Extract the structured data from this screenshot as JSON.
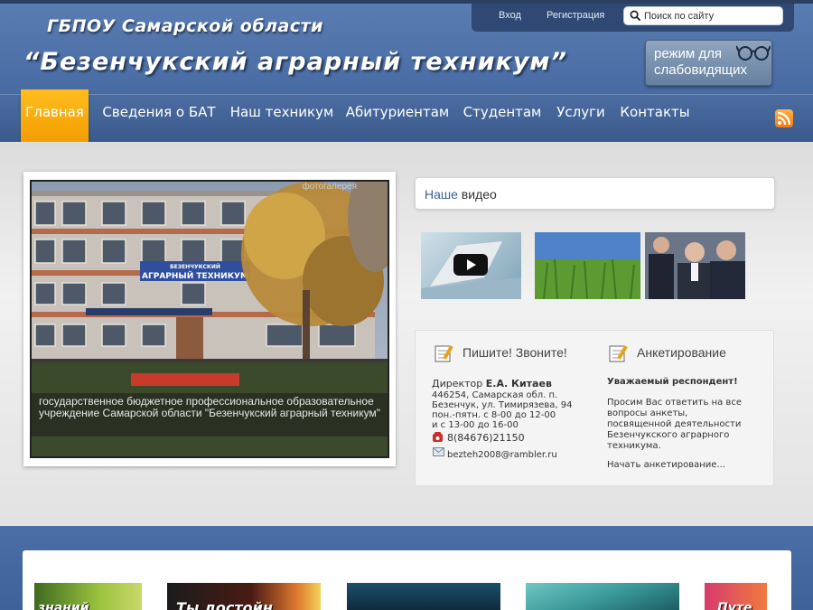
{
  "header": {
    "subtitle": "ГБПОУ Самарской области",
    "title": "“Безенчукский аграрный техникум”",
    "login": "Вход",
    "register": "Регистрация",
    "search_placeholder": "Поиск по сайту",
    "vision_line1": "режим для",
    "vision_line2": "слабовидящих"
  },
  "nav": {
    "items": [
      {
        "label": "Главная",
        "active": true
      },
      {
        "label": "Сведения о БАТ"
      },
      {
        "label": "Наш техникум"
      },
      {
        "label": "Абитуриентам"
      },
      {
        "label": "Студентам"
      },
      {
        "label": "Услуги"
      },
      {
        "label": "Контакты"
      }
    ]
  },
  "slider": {
    "gallery_label": "фотогалерея",
    "sign_top": "БЕЗЕНЧУКСКИЙ",
    "sign_main": "АГРАРНЫЙ ТЕХНИКУМ",
    "caption": "государственное бюджетное профессиональное образовательное учреждение Самарской области \"Безенчукский аграрный техникум\""
  },
  "video": {
    "title_highlight": "Наше",
    "title_rest": " видео"
  },
  "contacts": {
    "title": "Пишите! Звоните!",
    "director_label": "Директор ",
    "director_name": "Е.А. Китаев",
    "address_line1": "446254, Самарская обл. п.",
    "address_line2": "Безенчук, ул. Тимирязева, 94",
    "hours_line1": "пон.-пятн. с 8-00 до 12-00",
    "hours_line2": "и с 13-00 до 16-00",
    "phone": "8(84676)21150",
    "email": "bezteh2008@rambler.ru"
  },
  "survey": {
    "title": "Анкетирование",
    "greeting": "Уважаемый респондент!",
    "text_line1": "Просим Вас ответить на все",
    "text_line2": "вопросы анкеты,",
    "text_line3": "посвященной деятельности",
    "text_line4": "Безенчукского аграрного",
    "text_line5": "техникума.",
    "link": "Начать анкетирование..."
  },
  "banners": {
    "b1": "знаний",
    "b2": "Ты достойн",
    "b5": "Путе"
  },
  "colors": {
    "header_blue": "#4a6ea5",
    "nav_active": "#f7a80c",
    "link_blue": "#3b5f97"
  }
}
